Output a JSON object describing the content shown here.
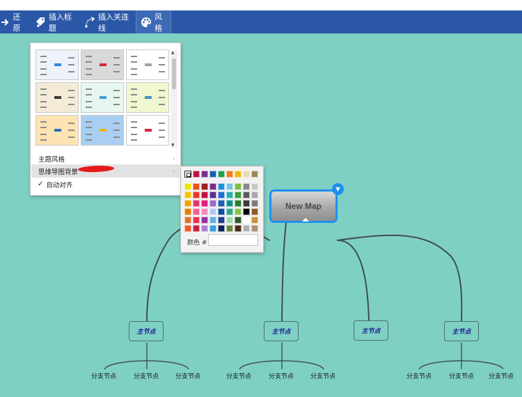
{
  "toolbar": {
    "undo_label": "还原",
    "insert_topic_label": "插入标题",
    "insert_relation_label": "插入关连线",
    "style_label": "风格"
  },
  "style_menu": {
    "theme_style_label": "主题风格",
    "map_background_label": "思维导图背景",
    "auto_align_label": "自动对齐",
    "auto_align_check": "✓",
    "arrow_glyph": "›",
    "scroll_up": "▲",
    "scroll_down": "▼",
    "themes": [
      {
        "name": "theme-1",
        "bg": "#eef2fb",
        "node": "#2a8be0"
      },
      {
        "name": "theme-2",
        "bg": "#d9d9d9",
        "node": "#d4263a"
      },
      {
        "name": "theme-3",
        "bg": "#ffffff",
        "node": "#9aa3ad"
      },
      {
        "name": "theme-4",
        "bg": "#f3ead8",
        "node": "#3a3a3a"
      },
      {
        "name": "theme-5",
        "bg": "#e6f7f0",
        "node": "#3fa0d8"
      },
      {
        "name": "theme-6",
        "bg": "#eef7d0",
        "node": "#4a8fc0"
      },
      {
        "name": "theme-7",
        "bg": "#fde3b3",
        "node": "#2e6fb0"
      },
      {
        "name": "theme-8",
        "bg": "#a8cff2",
        "node": "#e8b020"
      },
      {
        "name": "theme-9",
        "bg": "#ffffff",
        "node": "#e02030"
      }
    ]
  },
  "color_picker": {
    "label": "颜色 #",
    "hex_value": "",
    "top_row": [
      "#ffffff",
      "#c0143c",
      "#7b2d8e",
      "#1a5fb4",
      "#1ea050",
      "#f07d1e",
      "#f2b70e",
      "#e6d8b0",
      "#9b8a58"
    ],
    "grid": [
      [
        "#f2e300",
        "#e8501c",
        "#a01e1e",
        "#7b2d8e",
        "#1f8ed8",
        "#7ac4e0",
        "#7fbf3f",
        "#8a8a8a",
        "#c8c8c8"
      ],
      [
        "#f5c400",
        "#e83a1c",
        "#c0143c",
        "#5a2d8e",
        "#1a6fd0",
        "#2ab0b0",
        "#3ca03c",
        "#5a5a5a",
        "#aaaaaa"
      ],
      [
        "#f0a000",
        "#e8306a",
        "#e02080",
        "#9b6bd0",
        "#1a5fb4",
        "#129090",
        "#2e7d32",
        "#3a3a3a",
        "#7a7a7a"
      ],
      [
        "#e08000",
        "#f06090",
        "#f08cc0",
        "#b0c8f0",
        "#0e4fa0",
        "#2ea888",
        "#8bc34a",
        "#000000",
        "#8b5a2b"
      ],
      [
        "#e07030",
        "#e83050",
        "#9a30a0",
        "#60b0e8",
        "#1e3c8c",
        "#a0d8b0",
        "#2e5a2e",
        "#ffffff",
        "#c89040"
      ],
      [
        "#f05a28",
        "#c02040",
        "#b080d0",
        "#30a0e0",
        "#0a2060",
        "#6a8a3a",
        "#4a2a1a",
        "#b0b0b0",
        "#b09070"
      ]
    ]
  },
  "map": {
    "central_topic": "New Map",
    "collapse_icon": "▼",
    "main_topics": [
      "主节点",
      "主节点",
      "主节点",
      "主节点"
    ],
    "subtopics": [
      "分支节点",
      "分支节点",
      "分支节点",
      "分支节点",
      "分支节点",
      "分支节点",
      "分支节点",
      "分支节点",
      "分支节点"
    ]
  },
  "colors": {
    "background": "#7fd0c4",
    "toolbar": "#2b58a6",
    "accent": "#1f8ef0"
  }
}
